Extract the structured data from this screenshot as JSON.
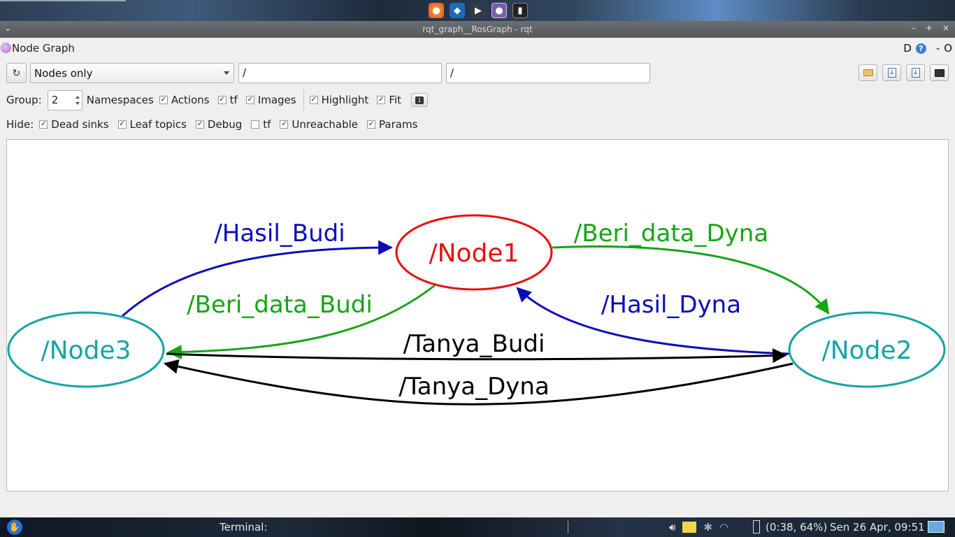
{
  "window": {
    "title": "rqt_graph__RosGraph - rqt",
    "controls": [
      "–",
      "+",
      "×"
    ]
  },
  "plugin": {
    "title": "Node Graph",
    "right_d": "D",
    "right_help": "?",
    "right_dash": "-",
    "right_o": "O"
  },
  "toolbar": {
    "refresh_icon": "refresh-icon",
    "mode_value": "Nodes only",
    "filter1_value": "/",
    "filter2_value": "/",
    "buttons": [
      "open-icon",
      "save-dot-icon",
      "save-svg-icon",
      "screenshot-icon"
    ]
  },
  "row2": {
    "group_label": "Group:",
    "group_value": "2",
    "namespaces_label": "Namespaces",
    "actions_label": "Actions",
    "actions_checked": true,
    "tf_label": "tf",
    "tf_checked": true,
    "images_label": "Images",
    "images_checked": true,
    "highlight_label": "Highlight",
    "highlight_checked": true,
    "fit_label": "Fit",
    "fit_checked": true,
    "fit_button_glyph": "1"
  },
  "row3": {
    "hide_label": "Hide:",
    "dead_sinks_label": "Dead sinks",
    "dead_sinks_checked": true,
    "leaf_topics_label": "Leaf topics",
    "leaf_topics_checked": true,
    "debug_label": "Debug",
    "debug_checked": true,
    "tf_label": "tf",
    "tf_checked": false,
    "unreachable_label": "Unreachable",
    "unreachable_checked": true,
    "params_label": "Params",
    "params_checked": true
  },
  "graph": {
    "nodes": {
      "node1": {
        "label": "/Node1",
        "color": "#e61010"
      },
      "node2": {
        "label": "/Node2",
        "color": "#16a3a6"
      },
      "node3": {
        "label": "/Node3",
        "color": "#16a3a6"
      }
    },
    "edges": {
      "hasil_budi": {
        "label": "/Hasil_Budi",
        "color": "#0b0bbb"
      },
      "beri_data_dyna": {
        "label": "/Beri_data_Dyna",
        "color": "#14a514"
      },
      "beri_data_budi": {
        "label": "/Beri_data_Budi",
        "color": "#14a514"
      },
      "hasil_dyna": {
        "label": "/Hasil_Dyna",
        "color": "#0b0bbb"
      },
      "tanya_budi": {
        "label": "/Tanya_Budi",
        "color": "#000000"
      },
      "tanya_dyna": {
        "label": "/Tanya_Dyna",
        "color": "#000000"
      }
    }
  },
  "taskbar": {
    "task_label": "Terminal:",
    "battery": "(0:38, 64%)",
    "clock": "Sen 26 Apr, 09:51"
  }
}
